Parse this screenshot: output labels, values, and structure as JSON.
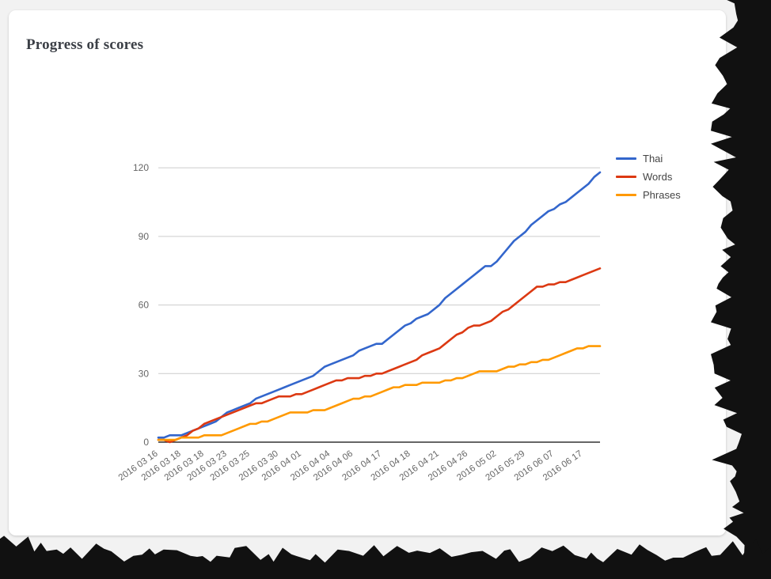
{
  "card": {
    "title": "Progress of scores"
  },
  "legend": {
    "position": "right",
    "items": [
      {
        "label": "Thai",
        "color": "#3366cc"
      },
      {
        "label": "Words",
        "color": "#dc3912"
      },
      {
        "label": "Phrases",
        "color": "#ff9900"
      }
    ]
  },
  "axis": {
    "y_ticks": [
      "0",
      "30",
      "60",
      "90",
      "120"
    ],
    "y_tick_values": [
      0,
      30,
      60,
      90,
      120
    ]
  },
  "chart_data": {
    "type": "line",
    "title": "Progress of scores",
    "xlabel": "",
    "ylabel": "",
    "ylim": [
      0,
      128
    ],
    "grid": true,
    "legend_position": "right",
    "x_tick_labels": [
      "2016 03 16",
      "2016 03 18",
      "2016 03 18",
      "2016 03 23",
      "2016 03 25",
      "2016 03 30",
      "2016 04 01",
      "2016 04 04",
      "2016 04 06",
      "2016 04 17",
      "2016 04 18",
      "2016 04 21",
      "2016 04 26",
      "2016 05 02",
      "2016 05 29",
      "2016 06 07",
      "2016 06 17"
    ],
    "x_tick_positions": [
      0,
      4,
      8,
      12,
      16,
      21,
      25,
      30,
      34,
      39,
      44,
      49,
      54,
      59,
      64,
      69,
      74
    ],
    "n_points": 78,
    "series": [
      {
        "name": "Thai",
        "color": "#3366cc",
        "values": [
          2,
          2,
          3,
          3,
          3,
          4,
          5,
          6,
          7,
          8,
          9,
          11,
          13,
          14,
          15,
          16,
          17,
          19,
          20,
          21,
          22,
          23,
          24,
          25,
          26,
          27,
          28,
          29,
          31,
          33,
          34,
          35,
          36,
          37,
          38,
          40,
          41,
          42,
          43,
          43,
          45,
          47,
          49,
          51,
          52,
          54,
          55,
          56,
          58,
          60,
          63,
          65,
          67,
          69,
          71,
          73,
          75,
          77,
          77,
          79,
          82,
          85,
          88,
          90,
          92,
          95,
          97,
          99,
          101,
          102,
          104,
          105,
          107,
          109,
          111,
          113,
          116,
          118
        ]
      },
      {
        "name": "Words",
        "color": "#dc3912",
        "values": [
          1,
          1,
          0,
          1,
          2,
          3,
          5,
          6,
          8,
          9,
          10,
          11,
          12,
          13,
          14,
          15,
          16,
          17,
          17,
          18,
          19,
          20,
          20,
          20,
          21,
          21,
          22,
          23,
          24,
          25,
          26,
          27,
          27,
          28,
          28,
          28,
          29,
          29,
          30,
          30,
          31,
          32,
          33,
          34,
          35,
          36,
          38,
          39,
          40,
          41,
          43,
          45,
          47,
          48,
          50,
          51,
          51,
          52,
          53,
          55,
          57,
          58,
          60,
          62,
          64,
          66,
          68,
          68,
          69,
          69,
          70,
          70,
          71,
          72,
          73,
          74,
          75,
          76
        ]
      },
      {
        "name": "Phrases",
        "color": "#ff9900",
        "values": [
          1,
          1,
          1,
          1,
          2,
          2,
          2,
          2,
          3,
          3,
          3,
          3,
          4,
          5,
          6,
          7,
          8,
          8,
          9,
          9,
          10,
          11,
          12,
          13,
          13,
          13,
          13,
          14,
          14,
          14,
          15,
          16,
          17,
          18,
          19,
          19,
          20,
          20,
          21,
          22,
          23,
          24,
          24,
          25,
          25,
          25,
          26,
          26,
          26,
          26,
          27,
          27,
          28,
          28,
          29,
          30,
          31,
          31,
          31,
          31,
          32,
          33,
          33,
          34,
          34,
          35,
          35,
          36,
          36,
          37,
          38,
          39,
          40,
          41,
          41,
          42,
          42,
          42
        ]
      }
    ]
  }
}
